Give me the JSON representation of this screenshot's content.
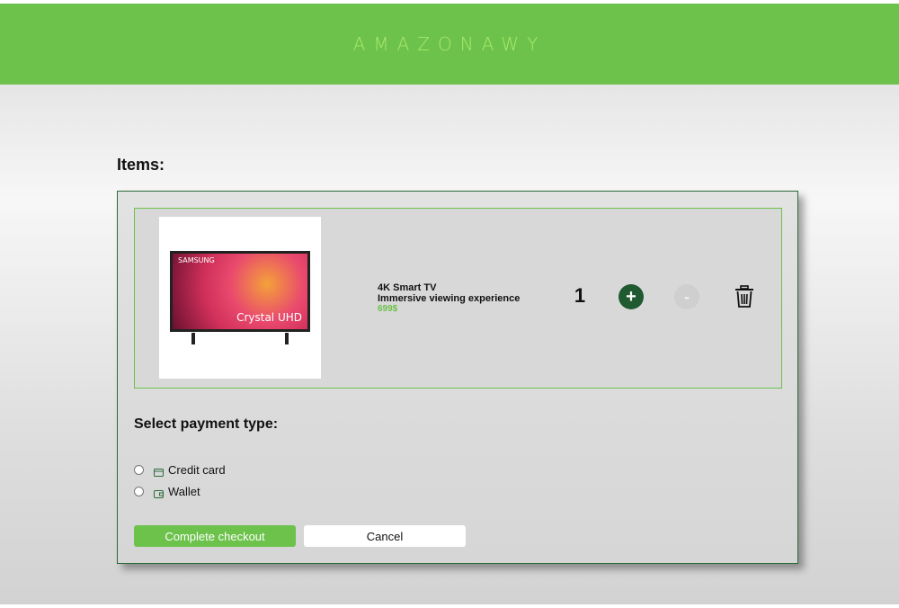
{
  "header": {
    "brand": "AMAZONAWY"
  },
  "cart": {
    "title": "Items:",
    "items": [
      {
        "name": "4K Smart TV",
        "description": "Immersive viewing experience",
        "price": "699$",
        "quantity": "1",
        "image": {
          "brand_text": "SAMSUNG",
          "overlay_text": "Crystal UHD"
        }
      }
    ],
    "plus_label": "+",
    "minus_label": "-",
    "delete_icon": "trash-icon"
  },
  "payment": {
    "title": "Select payment type:",
    "options": [
      {
        "label": "Credit card",
        "icon": "credit-card-icon"
      },
      {
        "label": "Wallet",
        "icon": "wallet-icon"
      }
    ]
  },
  "actions": {
    "checkout_label": "Complete checkout",
    "cancel_label": "Cancel"
  },
  "colors": {
    "accent": "#6cc24a",
    "dark_green": "#1f5a31",
    "brand_text": "#a9e86f"
  }
}
